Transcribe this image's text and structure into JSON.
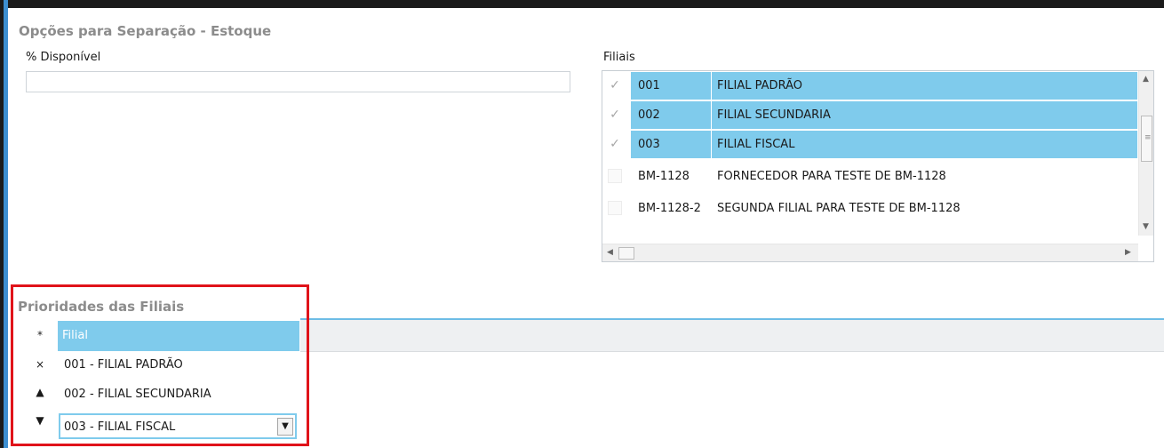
{
  "stock_section": {
    "title": "Opções para Separação - Estoque",
    "pct_label": "% Disponível",
    "pct_value": ""
  },
  "filiais": {
    "label": "Filiais",
    "rows": [
      {
        "code": "001",
        "name": "FILIAL PADRÃO",
        "checked": true
      },
      {
        "code": "002",
        "name": "FILIAL SECUNDARIA",
        "checked": true
      },
      {
        "code": "003",
        "name": "FILIAL FISCAL",
        "checked": true
      },
      {
        "code": "BM-1128",
        "name": "FORNECEDOR PARA TESTE DE BM-1128",
        "checked": false
      },
      {
        "code": "BM-1128-2",
        "name": "SEGUNDA FILIAL PARA TESTE DE BM-1128",
        "checked": false
      }
    ],
    "check_glyph": "✓",
    "scroll_up": "▲",
    "scroll_down": "▼",
    "scroll_left": "◀",
    "scroll_right": "▶",
    "grip": "≡"
  },
  "priorities": {
    "title": "Prioridades das Filiais",
    "header_icon": "*",
    "header_label": "Filial",
    "rows": [
      {
        "icon": "×",
        "icon_name": "delete-icon",
        "label": "001 - FILIAL PADRÃO"
      },
      {
        "icon": "▲",
        "icon_name": "move-up-icon",
        "label": "002 - FILIAL SECUNDARIA"
      }
    ],
    "editing_row": {
      "icon": "▼",
      "icon_name": "move-down-icon",
      "value": "003 - FILIAL FISCAL",
      "dropdown": "▼"
    }
  },
  "colors": {
    "selection": "#7fcbec",
    "highlight_border": "#e0131a",
    "section_title": "#8c8c8c"
  }
}
